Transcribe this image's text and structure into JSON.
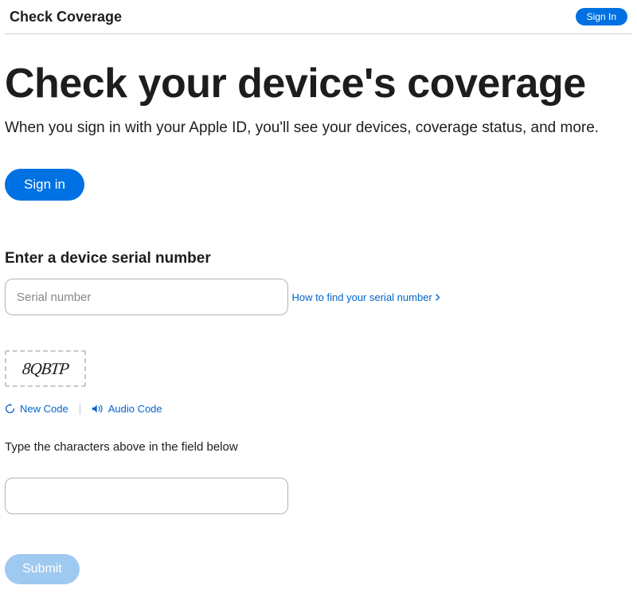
{
  "header": {
    "title": "Check Coverage",
    "sign_in_label": "Sign In"
  },
  "hero": {
    "title": "Check your device's coverage",
    "subtitle": "When you sign in with your Apple ID, you'll see your devices, coverage status, and more.",
    "sign_in_button": "Sign in"
  },
  "serial": {
    "section_title": "Enter a device serial number",
    "input_placeholder": "Serial number",
    "help_link": "How to find your serial number"
  },
  "captcha": {
    "image_text": "8QBTP",
    "new_code_label": "New Code",
    "audio_code_label": "Audio Code",
    "prompt": "Type the characters above in the field below"
  },
  "submit": {
    "label": "Submit"
  }
}
